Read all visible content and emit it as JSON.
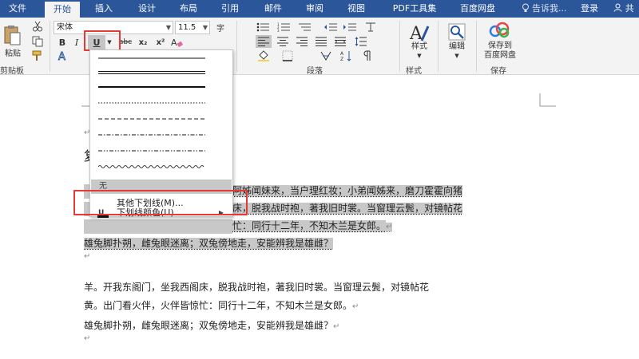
{
  "tabs": {
    "file": "文件",
    "home": "开始",
    "insert": "插入",
    "design": "设计",
    "layout": "布局",
    "references": "引用",
    "mailings": "邮件",
    "review": "审阅",
    "view": "视图",
    "pdf": "PDF工具集",
    "baidu": "百度网盘",
    "tell_me": "告诉我...",
    "login": "登录",
    "share": "共"
  },
  "ribbon": {
    "paste": "粘贴",
    "clipboard": "剪贴板",
    "font_name": "宋体",
    "font_size": "11.5",
    "bold": "B",
    "italic": "I",
    "underline": "U",
    "strike": "abc",
    "subscript": "x₂",
    "superscript": "x²",
    "font_color_a": "A",
    "paragraph": "段落",
    "styles": "样式",
    "styles_group": "样式",
    "editing": "编辑",
    "save_baidu_1": "保存到",
    "save_baidu_2": "百度网盘",
    "save_group": "保存",
    "phonetic": "字"
  },
  "dropdown": {
    "none_label": "无",
    "more_underlines": "其他下划线(M)...",
    "underline_color": "下划线颜色(U)"
  },
  "document": {
    "visible_heading_char": "复",
    "sel_line1": "阿姊闻妹来，当户理红妆；小弟闻姊来，磨刀霍霍向猪",
    "sel_line2_right": "床，脱我战时袍，著我旧时裳。当窗理云鬓，对镜帖花",
    "sel_line3_right": "忙：同行十二年，不知木兰是女郎。",
    "sel_line4": "雄兔脚扑朔，雌兔眼迷离；双兔傍地走，安能辨我是雄雌？",
    "line5": "羊。开我东阁门，坐我西阁床，脱我战时袍，著我旧时裳。当窗理云鬓，对镜帖花",
    "line6": "黄。出门看火伴，火伴皆惊忙：同行十二年，不知木兰是女郎。",
    "line7": "雄兔脚扑朔，雌兔眼迷离；双兔傍地走，安能辨我是雄雌？",
    "para_mark": "↵"
  },
  "colors": {
    "title_bar": "#2b579a",
    "highlight_red": "#e53935",
    "selection": "#c8c8c8",
    "baidu_blue": "#2f7de1"
  }
}
